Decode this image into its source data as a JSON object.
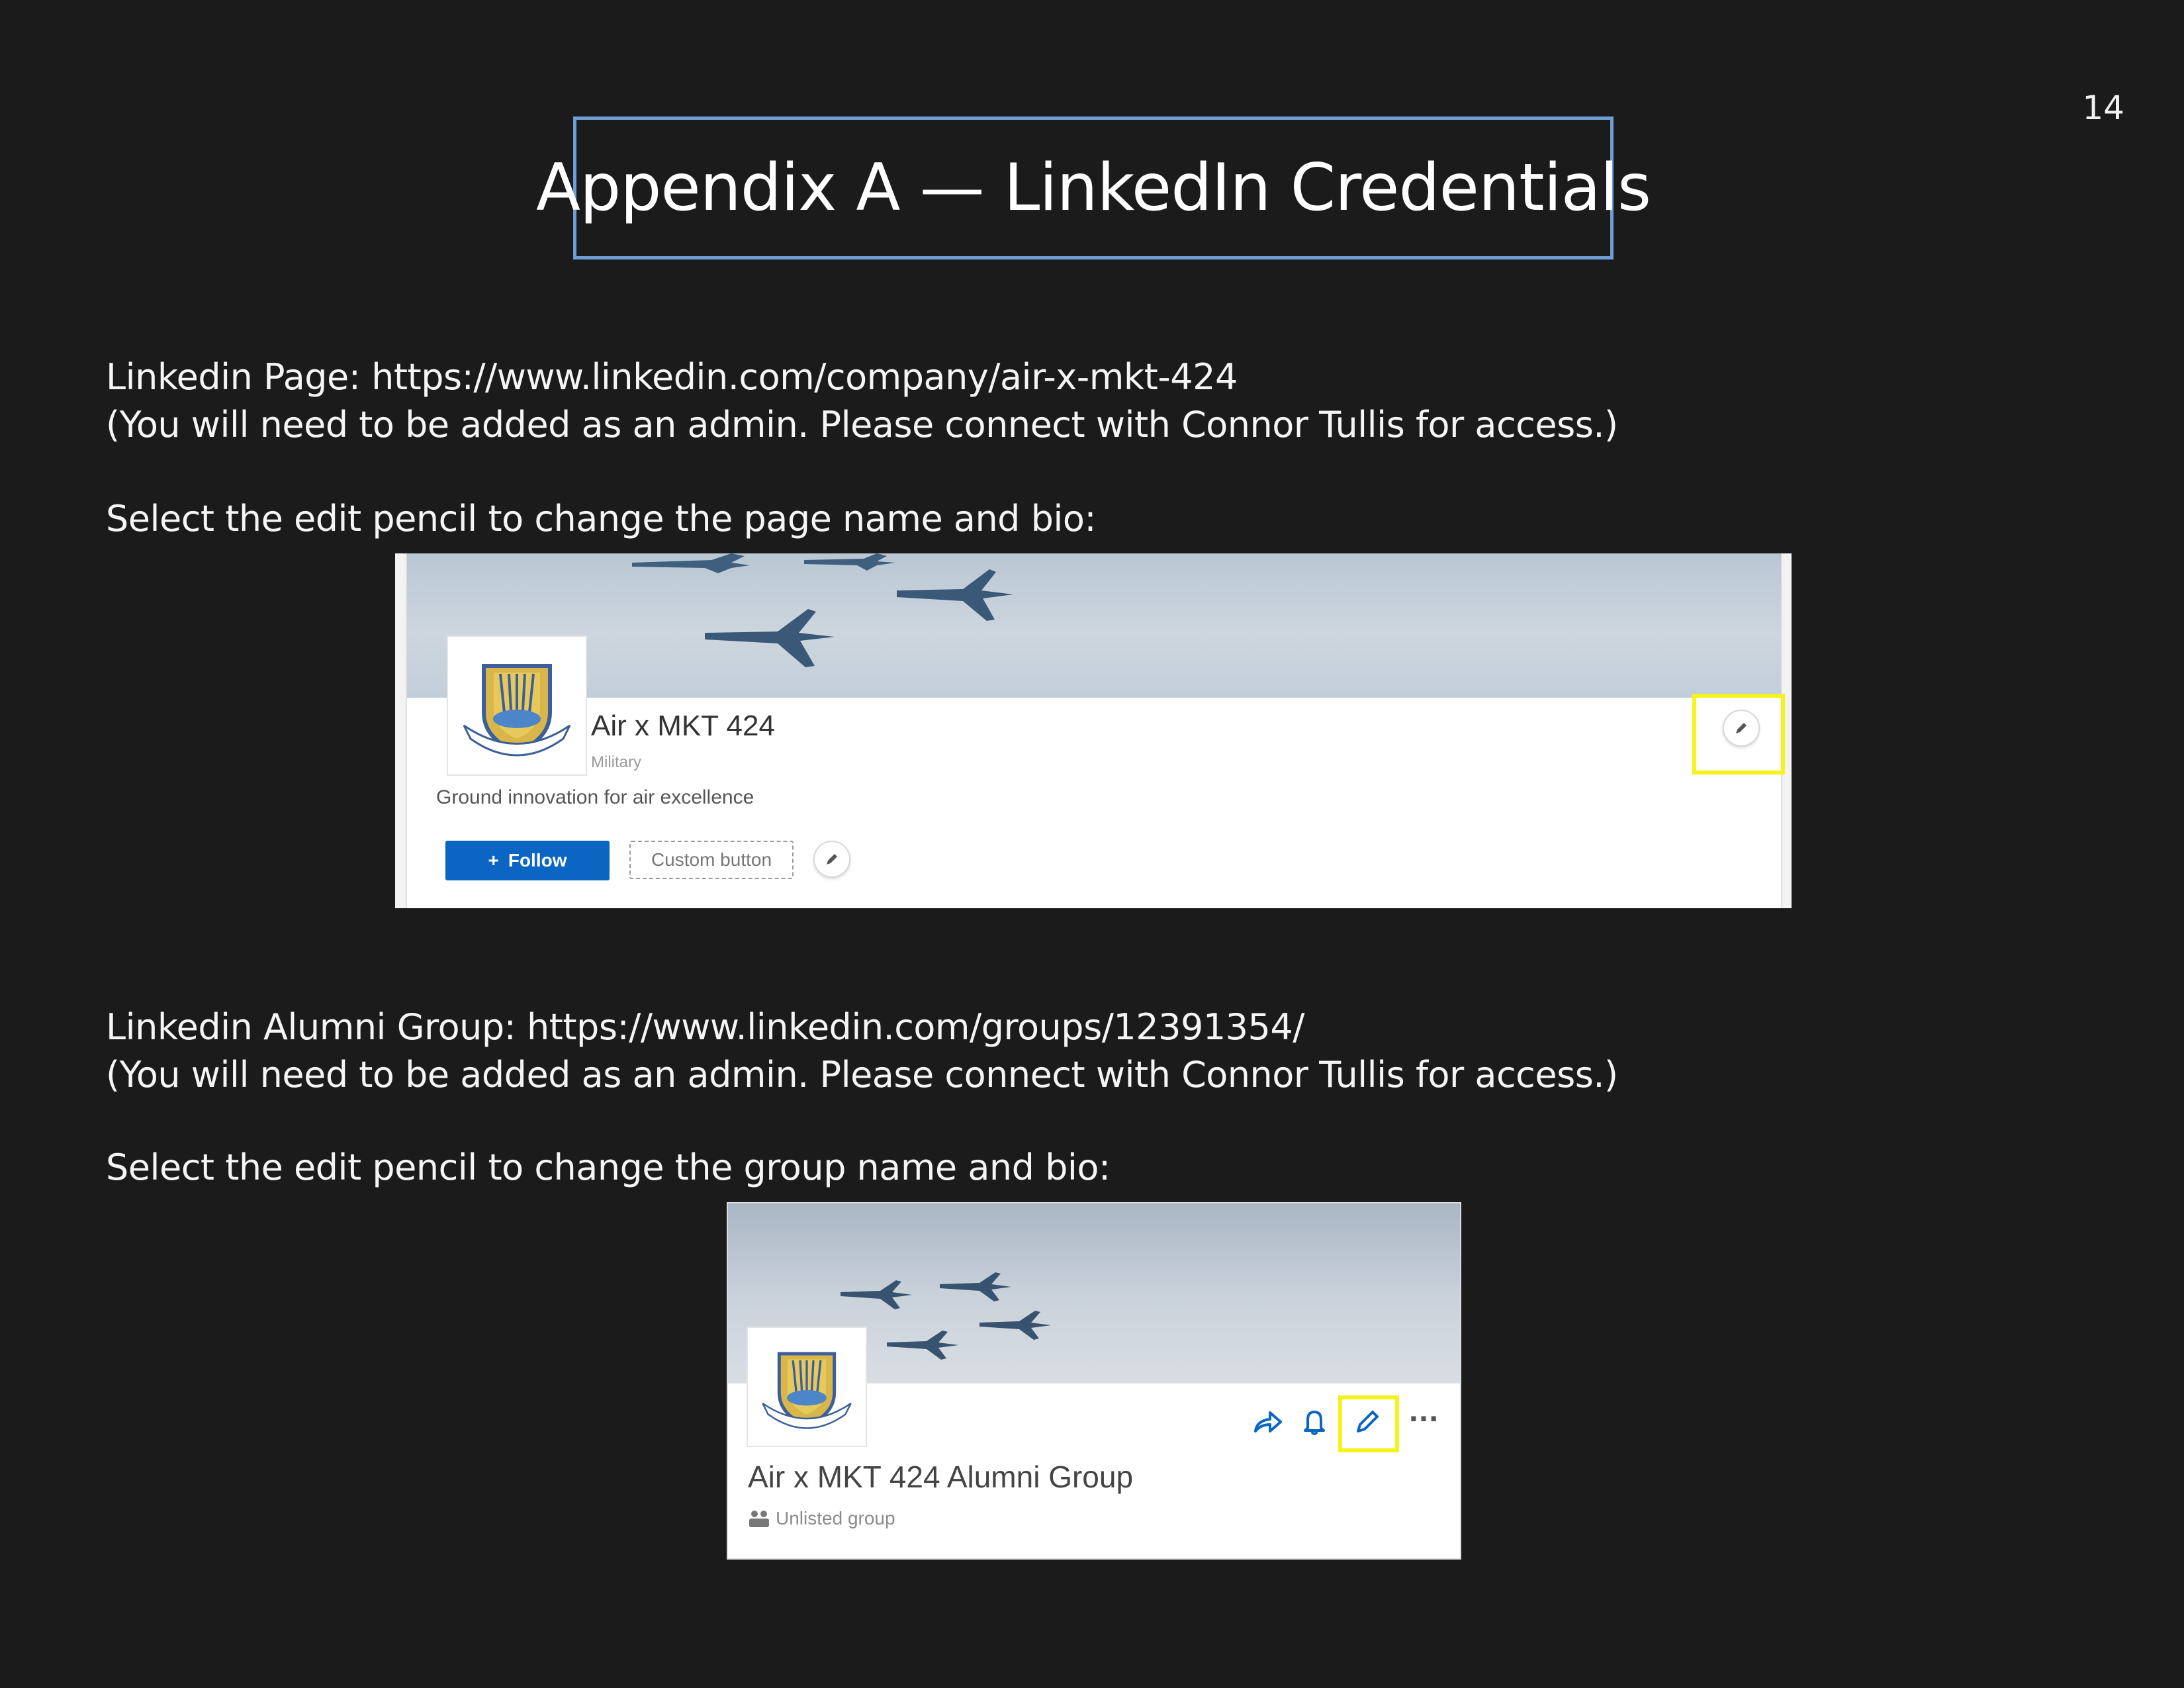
{
  "page_number": "14",
  "title": "Appendix A — LinkedIn Credentials",
  "section1": {
    "line1": "Linkedin Page: https://www.linkedin.com/company/air-x-mkt-424",
    "line2": " (You will need to be added as an admin. Please connect with Connor Tullis for access.)",
    "instruction": "Select the edit pencil to change the page name and bio:"
  },
  "screenshot1": {
    "company_name": "Air x MKT 424",
    "category": "Military",
    "tagline": "Ground innovation for air excellence",
    "follow_label": "Follow",
    "follow_plus": "+",
    "custom_button_label": "Custom button",
    "highlight_color": "#f5f21c",
    "icons": [
      "banner-edit-pencil-icon",
      "button-edit-pencil-icon",
      "logo-emblem"
    ]
  },
  "section2": {
    "line1": "Linkedin Alumni Group: https://www.linkedin.com/groups/12391354/",
    "line2": "(You will need to be added as an admin. Please connect with Connor Tullis for access.)",
    "instruction": "Select the edit pencil to change the group name and bio:"
  },
  "screenshot2": {
    "group_name": "Air x MKT 424 Alumni Group",
    "group_status": "Unlisted group",
    "more_label": "···",
    "icons": [
      "share-icon",
      "bell-icon",
      "edit-pencil-icon",
      "more-icon"
    ]
  },
  "colors": {
    "background": "#1b1b1b",
    "title_border": "#6e9ed3",
    "linkedin_blue": "#0a66c2",
    "highlight": "#f5f21c"
  }
}
